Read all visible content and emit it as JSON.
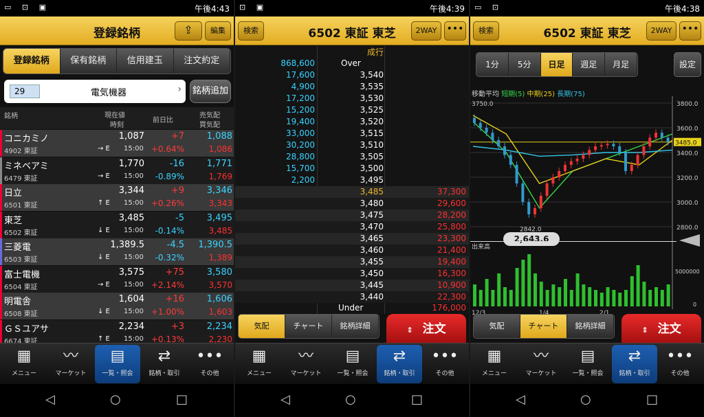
{
  "status": {
    "s1_time": "午後4:43",
    "s2_time": "午後4:39",
    "s3_time": "午後4:38"
  },
  "s1": {
    "title": "登録銘柄",
    "edit_label": "編集",
    "tabs": [
      "登録銘柄",
      "保有銘柄",
      "信用建玉",
      "注文約定"
    ],
    "category_num": "29",
    "category_name": "電気機器",
    "add_label": "銘柄追加",
    "head": {
      "name": "銘柄",
      "price": "現在値",
      "time": "時刻",
      "change": "前日比",
      "ask": "売気配",
      "bid": "買気配"
    },
    "stocks": [
      {
        "name": "コニカミノ",
        "code": "4902 東証",
        "price": "1,087",
        "arrow": "→ E",
        "time": "15:00",
        "change": "+7",
        "pct": "+0.64%",
        "ask": "1,088",
        "bid": "1,086",
        "dir": "up"
      },
      {
        "name": "ミネベアミ",
        "code": "6479 東証",
        "price": "1,770",
        "arrow": "→ E",
        "time": "15:00",
        "change": "-16",
        "pct": "-0.89%",
        "ask": "1,771",
        "bid": "1,769",
        "dir": "dn"
      },
      {
        "name": "日立",
        "code": "6501 東証",
        "price": "3,344",
        "arrow": "↑ E",
        "time": "15:00",
        "change": "+9",
        "pct": "+0.26%",
        "ask": "3,346",
        "bid": "3,343",
        "dir": "up"
      },
      {
        "name": "東芝",
        "code": "6502 東証",
        "price": "3,485",
        "arrow": "↓ E",
        "time": "15:00",
        "change": "-5",
        "pct": "-0.14%",
        "ask": "3,495",
        "bid": "3,485",
        "dir": "dn"
      },
      {
        "name": "三菱電",
        "code": "6503 東証",
        "price": "1,389.5",
        "arrow": "↓ E",
        "time": "15:00",
        "change": "-4.5",
        "pct": "-0.32%",
        "ask": "1,390.5",
        "bid": "1,389",
        "dir": "dn"
      },
      {
        "name": "富士電機",
        "code": "6504 東証",
        "price": "3,575",
        "arrow": "→ E",
        "time": "15:00",
        "change": "+75",
        "pct": "+2.14%",
        "ask": "3,580",
        "bid": "3,570",
        "dir": "up"
      },
      {
        "name": "明電舎",
        "code": "6508 東証",
        "price": "1,604",
        "arrow": "↓ E",
        "time": "15:00",
        "change": "+16",
        "pct": "+1.00%",
        "ask": "1,606",
        "bid": "1,603",
        "dir": "up"
      },
      {
        "name": "ＧＳユアサ",
        "code": "6674 東証",
        "price": "2,234",
        "arrow": "↑ E",
        "time": "15:00",
        "change": "+3",
        "pct": "+0.13%",
        "ask": "2,234",
        "bid": "2,230",
        "dir": "up"
      }
    ]
  },
  "s2": {
    "search_label": "検索",
    "title": "6502 東証 東芝",
    "twoway_label": "2WAY",
    "market_label": "成行",
    "over_qty": "868,600",
    "over_label": "Over",
    "asks": [
      [
        "17,600",
        "3,540"
      ],
      [
        "4,900",
        "3,535"
      ],
      [
        "17,200",
        "3,530"
      ],
      [
        "15,200",
        "3,525"
      ],
      [
        "19,400",
        "3,520"
      ],
      [
        "33,000",
        "3,515"
      ],
      [
        "30,200",
        "3,510"
      ],
      [
        "28,800",
        "3,505"
      ],
      [
        "15,700",
        "3,500"
      ],
      [
        "2,200",
        "3,495"
      ]
    ],
    "bids": [
      [
        "3,485",
        "37,300"
      ],
      [
        "3,480",
        "29,600"
      ],
      [
        "3,475",
        "28,200"
      ],
      [
        "3,470",
        "25,800"
      ],
      [
        "3,465",
        "23,300"
      ],
      [
        "3,460",
        "21,400"
      ],
      [
        "3,455",
        "19,400"
      ],
      [
        "3,450",
        "16,300"
      ],
      [
        "3,445",
        "10,900"
      ],
      [
        "3,440",
        "22,300"
      ]
    ],
    "under_label": "Under",
    "under_qty": "176,000",
    "subtabs": [
      "気配",
      "チャート",
      "銘柄詳細"
    ],
    "order_label": "注文"
  },
  "s3": {
    "search_label": "検索",
    "title": "6502 東証 東芝",
    "twoway_label": "2WAY",
    "periods": [
      "1分",
      "5分",
      "日足",
      "週足",
      "月足"
    ],
    "settings_label": "設定",
    "ma_label": "移動平均",
    "ma_short": "短期(5)",
    "ma_mid": "中期(25)",
    "ma_long": "長期(75)",
    "high_label": "3750.0",
    "low_label": "2842.0",
    "yticks": [
      "3800.0",
      "3600.0",
      "3400.0",
      "3200.0",
      "3000.0",
      "2800.0"
    ],
    "current_label": "3485.0",
    "cursor_value": "2,643.6",
    "volume_label": "出来高",
    "vol_tick": "5000000",
    "vol_zero": "0",
    "xticks": [
      "12/3",
      "1/4",
      "2/1"
    ],
    "subtabs": [
      "気配",
      "チャート",
      "銘柄詳細"
    ],
    "order_label": "注文"
  },
  "nav": {
    "items": [
      "メニュー",
      "マーケット",
      "一覧・照会",
      "銘柄・取引",
      "その他"
    ]
  },
  "chart_data": {
    "type": "line",
    "title": "",
    "x": [
      "12/3",
      "1/4",
      "2/1"
    ],
    "ylim": [
      2800,
      3800
    ],
    "series": [
      {
        "name": "短期(5)",
        "values": [
          3650,
          3400,
          2950,
          3250,
          3350,
          3450,
          3550
        ]
      },
      {
        "name": "中期(25)",
        "values": [
          3700,
          3550,
          3150,
          3250,
          3350,
          3300,
          3500
        ]
      },
      {
        "name": "長期(75)",
        "values": [
          3450,
          3420,
          3370,
          3380,
          3400,
          3400,
          3420
        ]
      }
    ]
  }
}
